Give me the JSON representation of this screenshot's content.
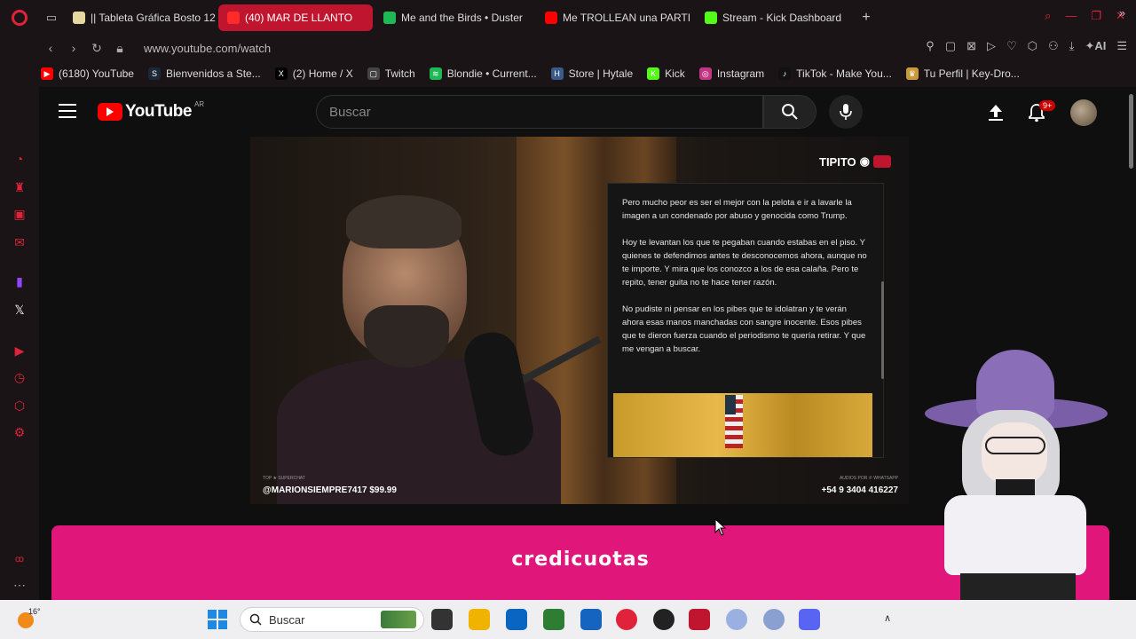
{
  "browser": {
    "tabs": [
      {
        "label": "|| Tableta Gráfica Bosto 12",
        "color": "#e6d9a0",
        "active": false
      },
      {
        "label": "(40) MAR DE LLANTO",
        "color": "#ff2b2b",
        "active": true
      },
      {
        "label": "Me and the Birds • Duster",
        "color": "#1db954",
        "active": false
      },
      {
        "label": "Me TROLLEAN una PARTI",
        "color": "#ff0000",
        "active": false
      },
      {
        "label": "Stream - Kick Dashboard",
        "color": "#53fc18",
        "active": false
      }
    ],
    "url": "www.youtube.com/watch",
    "ai_label": "AI",
    "bookmarks": [
      {
        "label": "(6180) YouTube",
        "color": "#ff0000",
        "glyph": "▶"
      },
      {
        "label": "Bienvenidos a Ste...",
        "color": "#1b2838",
        "glyph": "S"
      },
      {
        "label": "(2) Home / X",
        "color": "#000000",
        "glyph": "X"
      },
      {
        "label": "Twitch",
        "color": "#444444",
        "glyph": "▢"
      },
      {
        "label": "Blondie • Current...",
        "color": "#1db954",
        "glyph": "≋"
      },
      {
        "label": "Store | Hytale",
        "color": "#3a5a8a",
        "glyph": "H"
      },
      {
        "label": "Kick",
        "color": "#53fc18",
        "glyph": "K"
      },
      {
        "label": "Instagram",
        "color": "#c13584",
        "glyph": "◎"
      },
      {
        "label": "TikTok - Make You...",
        "color": "#111111",
        "glyph": "♪"
      },
      {
        "label": "Tu Perfil | Key-Dro...",
        "color": "#c89a3a",
        "glyph": "♛"
      }
    ]
  },
  "youtube": {
    "logo_text": "YouTube",
    "country": "AR",
    "search_placeholder": "Buscar",
    "notifications_badge": "9+"
  },
  "video": {
    "channel_watermark": "TIPITO",
    "tweet_paragraphs": [
      "Pero mucho peor es ser el mejor con la pelota e ir a lavarle la imagen a un condenado por abuso y genocida como Trump.",
      "Hoy te levantan los que te pegaban cuando estabas en el piso. Y quienes te defendimos antes te desconocemos ahora, aunque no te importe. Y mira que los conozco a los de esa calaña. Pero te repito, tener guita no te hace tener razón.",
      "No pudiste ni pensar en los pibes que te idolatran y te verán ahora esas manos manchadas con sangre inocente. Esos pibes que te dieron fuerza cuando el periodismo te quería retirar. Y que me vengan a buscar."
    ],
    "superchat": "@MARIONSIEMPRE7417 $99.99",
    "phone": "+54 9 3404 416227",
    "top_superchat_label": "TOP ★ SUPERCHAT",
    "audios_label": "AUDIOS POR ✆ WHATSAPP"
  },
  "ad": {
    "brand": "credicuotas",
    "color": "#e0167a"
  },
  "taskbar": {
    "temperature": "16°",
    "search_placeholder": "Buscar"
  }
}
